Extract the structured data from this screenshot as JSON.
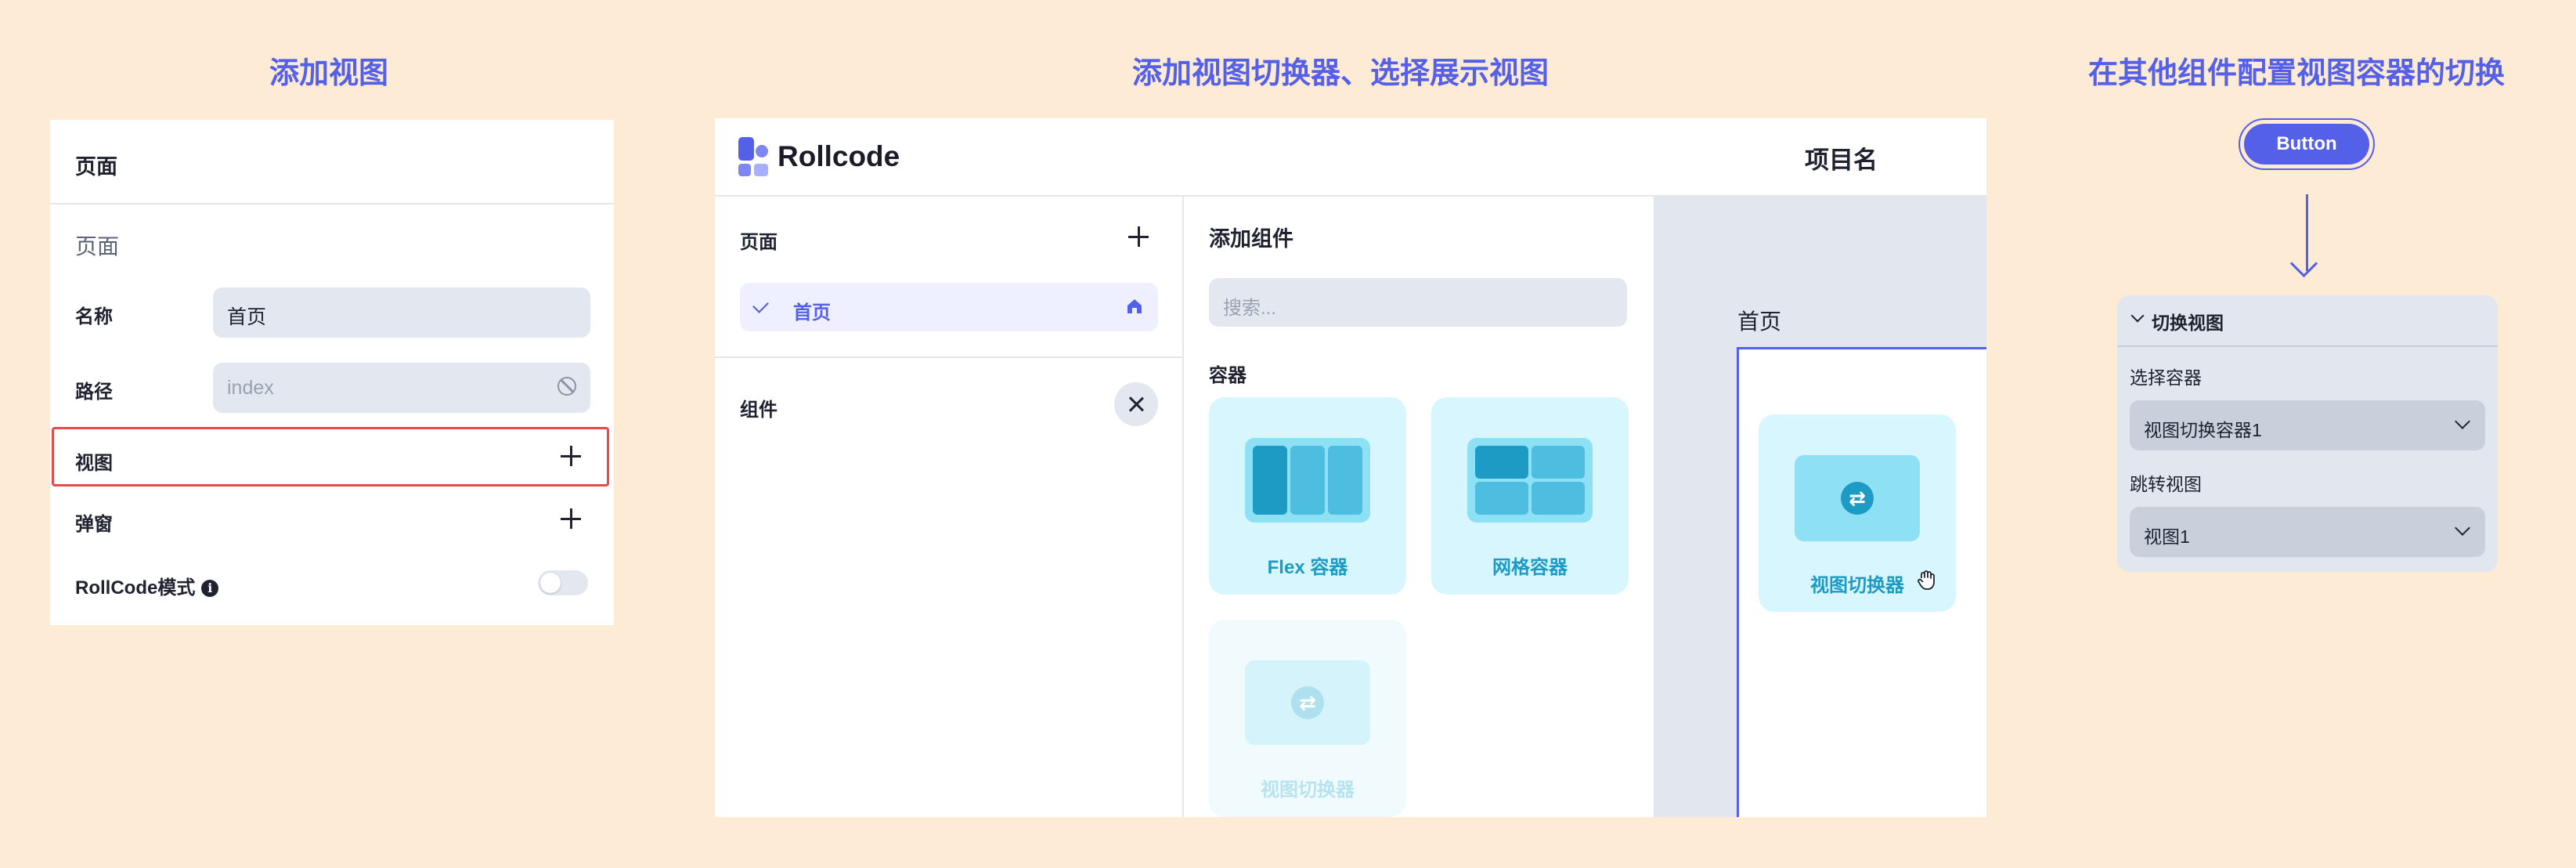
{
  "captions": {
    "left": "添加视图",
    "middle": "添加视图切换器、选择展示视图",
    "right": "在其他组件配置视图容器的切换"
  },
  "panel1": {
    "header": "页面",
    "section": "页面",
    "name_label": "名称",
    "name_value": "首页",
    "path_label": "路径",
    "path_placeholder": "index",
    "views_label": "视图",
    "popup_label": "弹窗",
    "rollcode_label": "RollCode模式",
    "info_glyph": "i",
    "rollcode_mode_on": false
  },
  "panel2": {
    "brand": "Rollcode",
    "project_name": "项目名",
    "pages_title": "页面",
    "page_item": "首页",
    "components_title": "组件",
    "add_components_title": "添加组件",
    "search_placeholder": "搜索...",
    "category": "容器",
    "cards": [
      "Flex 容器",
      "网格容器",
      "视图切换器"
    ],
    "canvas_page_label": "首页",
    "canvas_component": "视图切换器",
    "swap_glyph": "⇄"
  },
  "panel3": {
    "button": "Button",
    "section_title": "切换视图",
    "select_container_label": "选择容器",
    "select_container_value": "视图切换容器1",
    "target_view_label": "跳转视图",
    "target_view_value": "视图1"
  },
  "colors": {
    "background": "#fdebd6",
    "accent": "#5560e8",
    "highlight_border": "#e74a4a",
    "card_bg": "#d7f6fd",
    "card_text": "#1d9bc4"
  }
}
